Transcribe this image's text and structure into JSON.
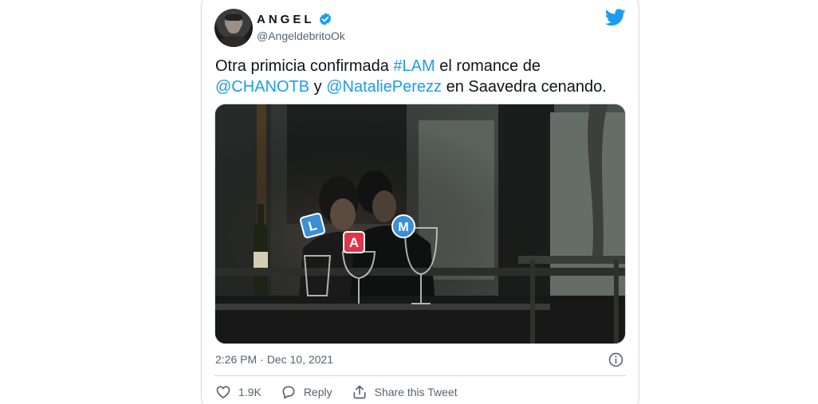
{
  "author": {
    "display_name": "ANGEL",
    "handle": "@AngeldebritoOk",
    "verified": true
  },
  "tweet": {
    "text_part1": "Otra primicia confirmada ",
    "hashtag": "#LAM",
    "text_part2": " el romance de ",
    "mention1": "@CHANOTB",
    "text_part3": " y ",
    "mention2": "@NataliePerezz",
    "text_part4": " en Saavedra cenando.",
    "time": "2:26 PM",
    "separator": "·",
    "date": "Dec 10, 2021"
  },
  "media": {
    "badges": [
      "L",
      "A",
      "M"
    ]
  },
  "actions": {
    "like_count": "1.9K",
    "reply_label": "Reply",
    "share_label": "Share this Tweet"
  },
  "colors": {
    "accent": "#1d9bf0",
    "text": "#0f1419",
    "muted": "#536471",
    "badge_blue": "#3b8ed8",
    "badge_red": "#e0344a"
  },
  "icons": {
    "brand": "twitter-bird-icon",
    "verified": "verified-badge-icon",
    "info": "info-icon",
    "like": "heart-icon",
    "reply": "speech-bubble-icon",
    "share": "share-icon"
  }
}
